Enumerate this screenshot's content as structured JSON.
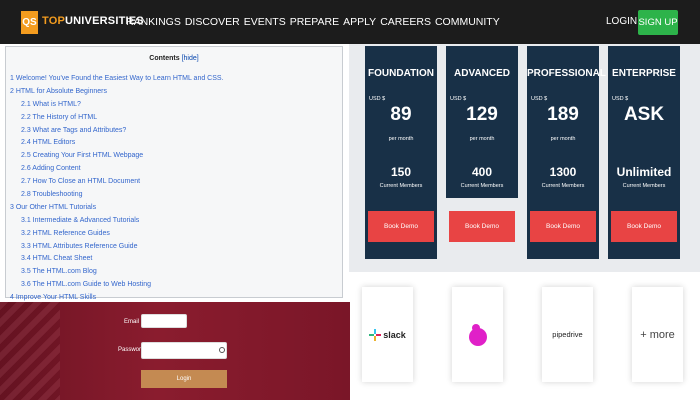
{
  "nav": {
    "logo_badge": "QS",
    "logo_top": "TOP",
    "logo_uni": "UNIVERSITIES",
    "links": [
      "RANKINGS",
      "DISCOVER",
      "EVENTS",
      "PREPARE",
      "APPLY",
      "CAREERS",
      "COMMUNITY"
    ],
    "login": "LOGIN",
    "signup": "SIGN UP"
  },
  "contents": {
    "title": "Contents",
    "hide": "[hide]",
    "items": [
      {
        "text": "1 Welcome! You've Found the Easiest Way to Learn HTML and CSS.",
        "level": 1
      },
      {
        "text": "2 HTML for Absolute Beginners",
        "level": 1
      },
      {
        "text": "2.1 What is HTML?",
        "level": 2
      },
      {
        "text": "2.2 The History of HTML",
        "level": 2
      },
      {
        "text": "2.3 What are Tags and Attributes?",
        "level": 2
      },
      {
        "text": "2.4 HTML Editors",
        "level": 2
      },
      {
        "text": "2.5 Creating Your First HTML Webpage",
        "level": 2
      },
      {
        "text": "2.6 Adding Content",
        "level": 2
      },
      {
        "text": "2.7 How To Close an HTML Document",
        "level": 2
      },
      {
        "text": "2.8 Troubleshooting",
        "level": 2
      },
      {
        "text": "3 Our Other HTML Tutorials",
        "level": 1
      },
      {
        "text": "3.1 Intermediate & Advanced Tutorials",
        "level": 2
      },
      {
        "text": "3.2 HTML Reference Guides",
        "level": 2
      },
      {
        "text": "3.3 HTML Attributes Reference Guide",
        "level": 2
      },
      {
        "text": "3.4 HTML Cheat Sheet",
        "level": 2
      },
      {
        "text": "3.5 The HTML.com Blog",
        "level": 2
      },
      {
        "text": "3.6 The HTML.com Guide to Web Hosting",
        "level": 2
      },
      {
        "text": "4 Improve Your HTML Skills",
        "level": 1
      }
    ]
  },
  "pricing": {
    "plans": [
      {
        "name": "FOUNDATION",
        "currency": "USD $",
        "price": "89",
        "period": "per month",
        "members": "150",
        "members_label": "Current Members",
        "button": "Book Demo"
      },
      {
        "name": "ADVANCED",
        "currency": "USD $",
        "price": "129",
        "period": "per month",
        "members": "400",
        "members_label": "Current Members",
        "button": "Book Demo"
      },
      {
        "name": "PROFESSIONAL",
        "currency": "USD $",
        "price": "189",
        "period": "per month",
        "members": "1300",
        "members_label": "Current Members",
        "button": "Book Demo"
      },
      {
        "name": "ENTERPRISE",
        "currency": "USD $",
        "price": "ASK",
        "period": "",
        "members": "Unlimited",
        "members_label": "Current Members",
        "button": "Book Demo"
      }
    ]
  },
  "login": {
    "email_label": "Email",
    "email_value": "",
    "password_label": "Password",
    "password_value": "",
    "button": "Login"
  },
  "logos": {
    "slack": "slack",
    "pipedrive": "pipedrive",
    "more": "+ more"
  },
  "colors": {
    "nav_bg": "#1c1c1c",
    "accent_orange": "#f39c1f",
    "signup_green": "#2db34a",
    "card_navy": "#183047",
    "demo_red": "#e84444",
    "login_bg": "#7a1628",
    "login_button": "#c48a52",
    "blob_magenta": "#e020c8"
  }
}
